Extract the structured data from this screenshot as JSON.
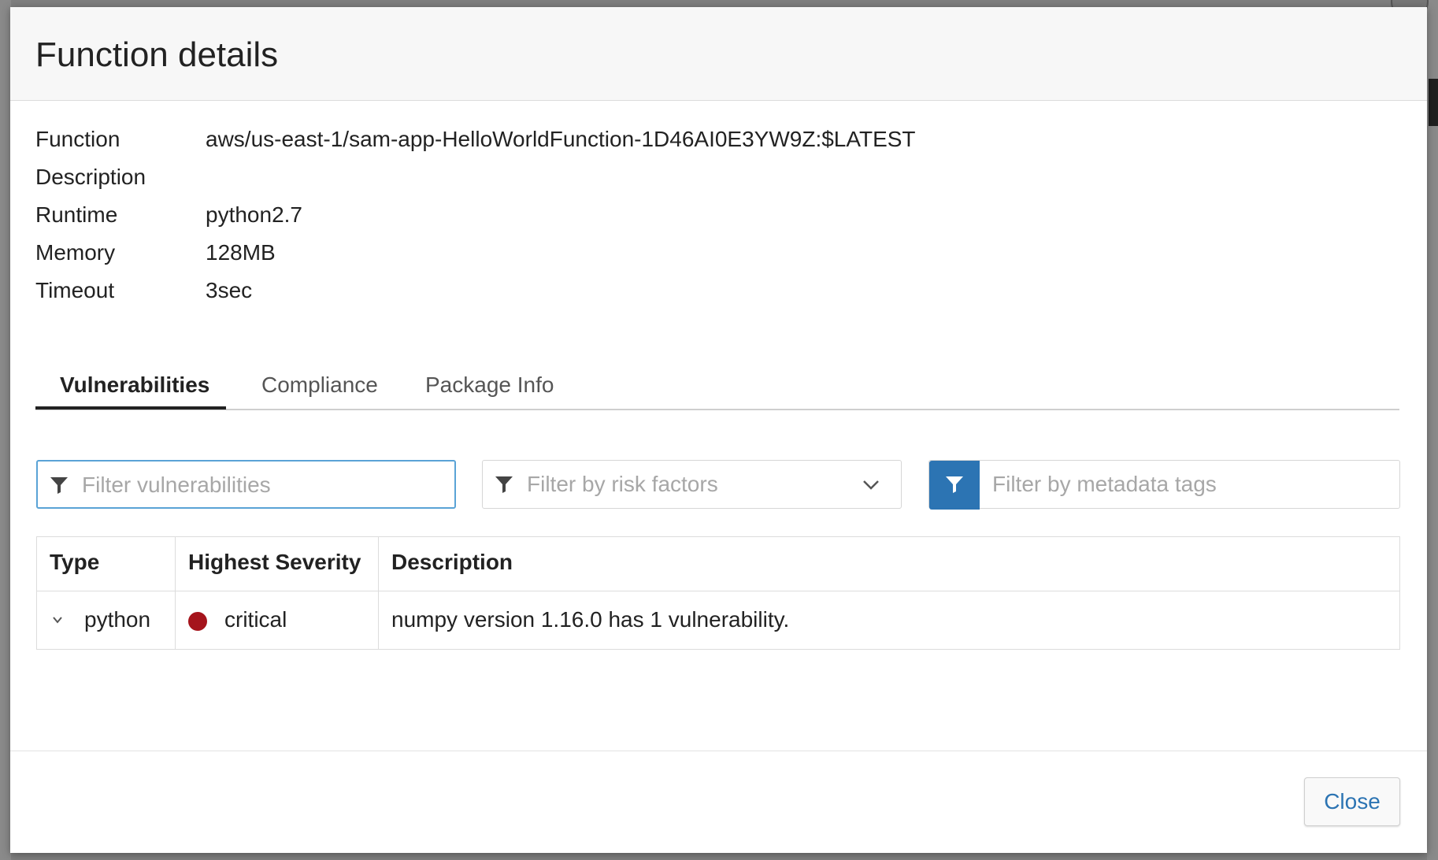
{
  "modal": {
    "title": "Function details"
  },
  "details": [
    {
      "label": "Function",
      "value": "aws/us-east-1/sam-app-HelloWorldFunction-1D46AI0E3YW9Z:$LATEST"
    },
    {
      "label": "Description",
      "value": ""
    },
    {
      "label": "Runtime",
      "value": "python2.7"
    },
    {
      "label": "Memory",
      "value": "128MB"
    },
    {
      "label": "Timeout",
      "value": "3sec"
    }
  ],
  "tabs": [
    {
      "label": "Vulnerabilities",
      "active": true
    },
    {
      "label": "Compliance",
      "active": false
    },
    {
      "label": "Package Info",
      "active": false
    }
  ],
  "filters": {
    "vulnerabilities_placeholder": "Filter vulnerabilities",
    "risk_factors_placeholder": "Filter by risk factors",
    "metadata_tags_placeholder": "Filter by metadata tags"
  },
  "table": {
    "headers": [
      "Type",
      "Highest Severity",
      "Description"
    ],
    "rows": [
      {
        "type": "python",
        "severity": "critical",
        "description": "numpy version 1.16.0 has 1 vulnerability."
      }
    ]
  },
  "colors": {
    "accent": "#2c74b3",
    "critical": "#a5141c"
  },
  "footer": {
    "close_label": "Close"
  }
}
